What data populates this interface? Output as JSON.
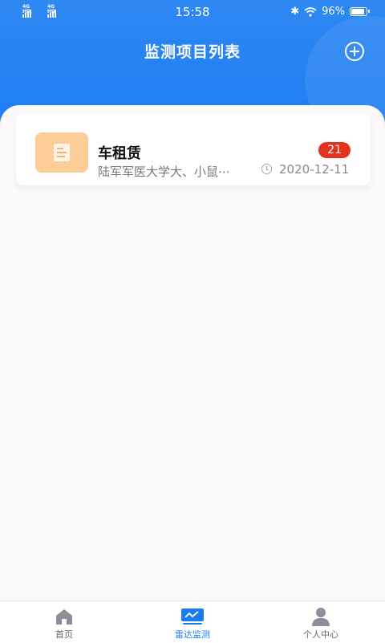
{
  "status_bar": {
    "network_1": "4G HD",
    "network_2": "4G HD",
    "time": "15:58",
    "battery": "96%",
    "battery_level": 0.96
  },
  "header": {
    "title": "监测项目列表",
    "add_icon": "plus-circle-icon"
  },
  "projects": [
    {
      "name": "车租赁",
      "subtitle": "陆军军医大学大、小鼠⋯",
      "badge": "21",
      "date": "2020-12-11",
      "icon": "document-icon",
      "icon_color": "#fccd96"
    }
  ],
  "tabbar": {
    "tabs": [
      {
        "label": "首页",
        "icon": "home-icon",
        "active": false
      },
      {
        "label": "雷达监测",
        "icon": "radar-monitor-icon",
        "active": true
      },
      {
        "label": "个人中心",
        "icon": "user-icon",
        "active": false
      }
    ]
  },
  "colors": {
    "primary": "#1b7cf2",
    "badge": "#e5321e",
    "background": "#fbf9fa"
  }
}
